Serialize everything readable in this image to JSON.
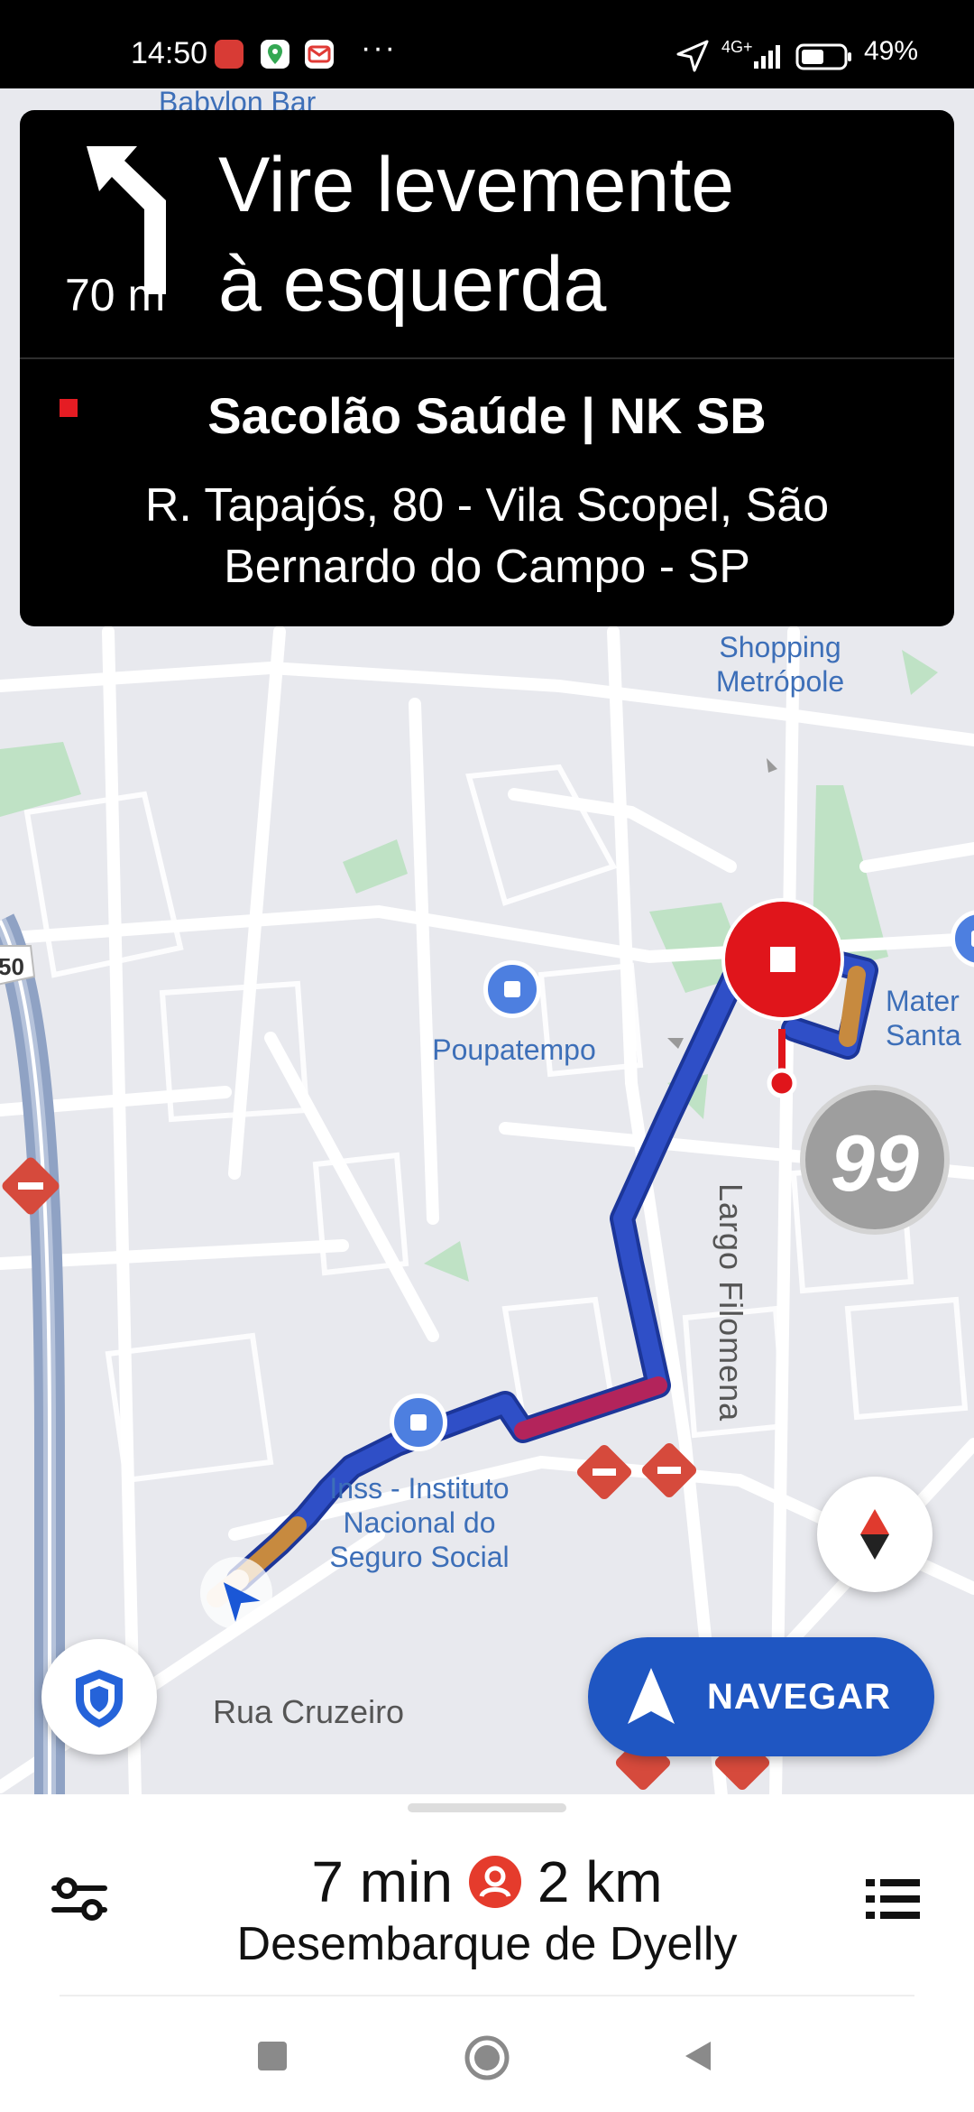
{
  "status_bar": {
    "time": "14:50",
    "more": "···",
    "network": "4G+",
    "battery": "49%"
  },
  "nav_card": {
    "distance": "70 m",
    "instruction_line1": "Vire levemente",
    "instruction_line2": "à esquerda",
    "destination_name": "Sacolão Saúde | NK SB",
    "address_line1": "R. Tapajós, 80 - Vila Scopel, São",
    "address_line2": "Bernardo do Campo - SP",
    "turn_icon": "slight-left-arrow-icon"
  },
  "map": {
    "labels": {
      "babylon": "Babylon Bar",
      "shopping_line1": "Shopping",
      "shopping_line2": "Metrópole",
      "poupatempo": "Poupatempo",
      "mater_line1": "Mater",
      "mater_line2": "Santa",
      "largo": "Largo Filomena",
      "inss_line1": "Inss - Instituto",
      "inss_line2": "Nacional do",
      "inss_line3": "Seguro Social",
      "rua_cruzeiro": "Rua Cruzeiro",
      "highway_shield": "50",
      "badge_99": "99"
    },
    "colors": {
      "route": "#2f4fc7",
      "traffic_heavy": "#b3245b",
      "traffic_moderate": "#c78a3f",
      "destination_pin": "#e0151b"
    }
  },
  "navigate_button": {
    "label": "NAVEGAR"
  },
  "bottom_panel": {
    "eta": "7 min",
    "distance": "2 km",
    "subtitle": "Desembarque de Dyelly"
  }
}
